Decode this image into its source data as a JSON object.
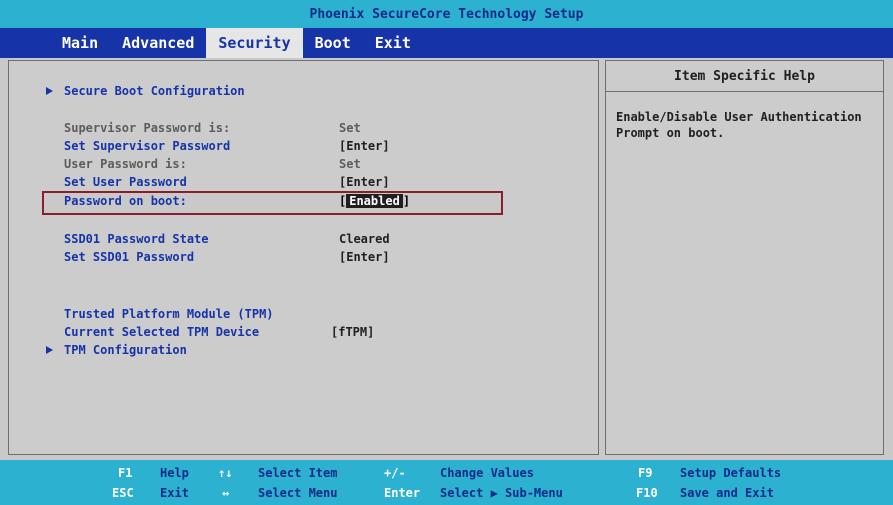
{
  "title": "Phoenix SecureCore Technology Setup",
  "menu": {
    "tabs": [
      {
        "label": "Main"
      },
      {
        "label": "Advanced"
      },
      {
        "label": "Security"
      },
      {
        "label": "Boot"
      },
      {
        "label": "Exit"
      }
    ],
    "active": "Security"
  },
  "security": {
    "secure_boot": "Secure Boot Configuration",
    "supervisor_password_is": {
      "label": "Supervisor Password is:",
      "value": "Set"
    },
    "set_supervisor_password": {
      "label": "Set Supervisor Password",
      "value": "[Enter]"
    },
    "user_password_is": {
      "label": "User Password is:",
      "value": "Set"
    },
    "set_user_password": {
      "label": "Set User Password",
      "value": "[Enter]"
    },
    "password_on_boot": {
      "label": "Password on boot:",
      "value": "Enabled"
    },
    "ssd_state": {
      "label": "SSD01 Password State",
      "value": "Cleared"
    },
    "set_ssd": {
      "label": "Set SSD01 Password",
      "value": "[Enter]"
    },
    "tpm": {
      "label": "Trusted Platform Module (TPM)"
    },
    "tpm_device": {
      "label": "Current Selected TPM Device",
      "value": "[fTPM]"
    },
    "tpm_config": "TPM Configuration"
  },
  "help": {
    "title": "Item Specific Help",
    "text": "Enable/Disable User Authentication Prompt on boot."
  },
  "footer": {
    "f1_key": "F1",
    "f1_desc": "Help",
    "arrows_key": "↑↓",
    "arrows_desc": "Select Item",
    "plusminus_key": "+/-",
    "plusminus_desc": "Change Values",
    "f9_key": "F9",
    "f9_desc": "Setup Defaults",
    "esc_key": "ESC",
    "esc_desc": "Exit",
    "lr_key": "↔",
    "lr_desc": "Select Menu",
    "enter_key": "Enter",
    "enter_desc": "Select ▶ Sub-Menu",
    "f10_key": "F10",
    "f10_desc": "Save and Exit"
  }
}
